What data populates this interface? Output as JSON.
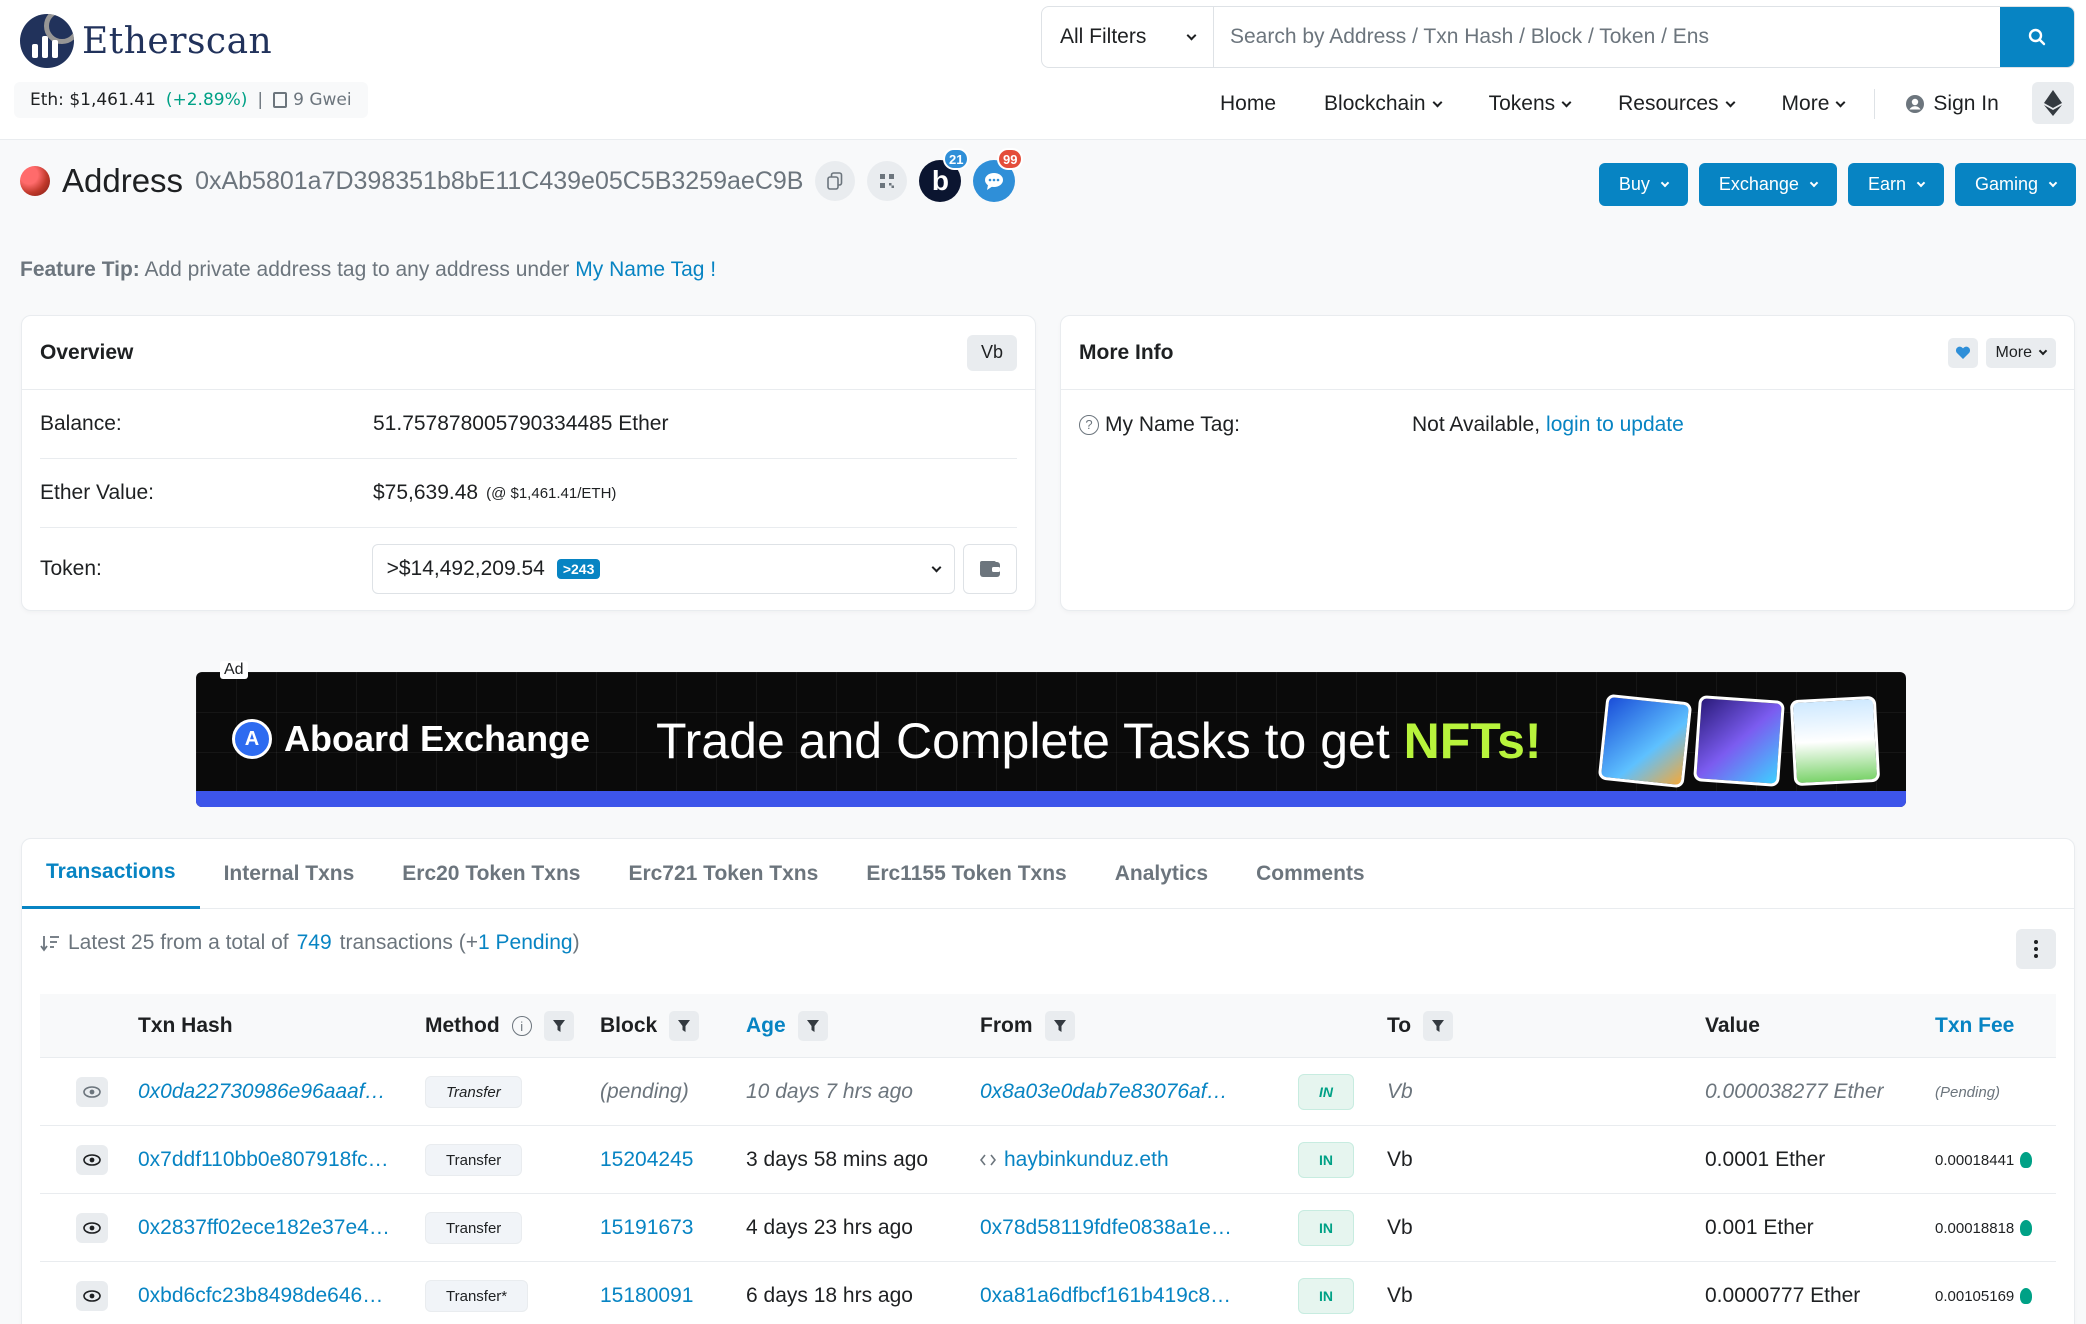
{
  "header": {
    "logo_text": "Etherscan",
    "eth_price": "Eth: $1,461.41",
    "eth_change": "(+2.89%)",
    "separator": "|",
    "gas": "9 Gwei",
    "search": {
      "filter_label": "All Filters",
      "placeholder": "Search by Address / Txn Hash / Block / Token / Ens"
    },
    "nav": [
      {
        "label": "Home"
      },
      {
        "label": "Blockchain"
      },
      {
        "label": "Tokens"
      },
      {
        "label": "Resources"
      },
      {
        "label": "More"
      }
    ],
    "sign_in": "Sign In"
  },
  "address": {
    "title": "Address",
    "hash": "0xAb5801a7D398351b8bE11C439e05C5B3259aeC9B",
    "b_badge_letter": "b",
    "b_badge_count": "21",
    "chat_badge_count": "99",
    "actions": [
      {
        "label": "Buy"
      },
      {
        "label": "Exchange"
      },
      {
        "label": "Earn"
      },
      {
        "label": "Gaming"
      }
    ]
  },
  "tip": {
    "label": "Feature Tip:",
    "text": "Add private address tag to any address under",
    "link": "My Name Tag !"
  },
  "overview": {
    "title": "Overview",
    "tag": "Vb",
    "balance_label": "Balance:",
    "balance_value": "51.757878005790334485 Ether",
    "ether_value_label": "Ether Value:",
    "ether_value": "$75,639.48",
    "ether_value_note": "(@ $1,461.41/ETH)",
    "token_label": "Token:",
    "token_value": ">$14,492,209.54",
    "token_count": ">243"
  },
  "more_info": {
    "title": "More Info",
    "more_label": "More",
    "name_tag_label": "My Name Tag:",
    "name_tag_value": "Not Available,",
    "name_tag_link": "login to update"
  },
  "ad": {
    "label": "Ad",
    "brand": "Aboard Exchange",
    "tagline": "Trade and Complete Tasks to get ",
    "tagline_highlight": "NFTs!"
  },
  "transactions": {
    "tabs": [
      {
        "label": "Transactions"
      },
      {
        "label": "Internal Txns"
      },
      {
        "label": "Erc20 Token Txns"
      },
      {
        "label": "Erc721 Token Txns"
      },
      {
        "label": "Erc1155 Token Txns"
      },
      {
        "label": "Analytics"
      },
      {
        "label": "Comments"
      }
    ],
    "summary_prefix": "Latest 25 from a total of",
    "summary_total": "749",
    "summary_mid": "transactions (+",
    "summary_pending": "1 Pending",
    "summary_suffix": ")",
    "columns": {
      "hash": "Txn Hash",
      "method": "Method",
      "block": "Block",
      "age": "Age",
      "from": "From",
      "to": "To",
      "value": "Value",
      "fee": "Txn Fee"
    },
    "rows": [
      {
        "hash": "0x0da22730986e96aaaf…",
        "method": "Transfer",
        "block": "(pending)",
        "age": "10 days 7 hrs ago",
        "from": "0x8a03e0dab7e83076af…",
        "direction": "IN",
        "to": "Vb",
        "value": "0.000038277 Ether",
        "fee": "(Pending)"
      },
      {
        "hash": "0x7ddf110bb0e807918fc…",
        "method": "Transfer",
        "block": "15204245",
        "age": "3 days 58 mins ago",
        "from": "haybinkunduz.eth",
        "direction": "IN",
        "to": "Vb",
        "value": "0.0001 Ether",
        "fee": "0.00018441"
      },
      {
        "hash": "0x2837ff02ece182e37e4…",
        "method": "Transfer",
        "block": "15191673",
        "age": "4 days 23 hrs ago",
        "from": "0x78d58119fdfe0838a1e…",
        "direction": "IN",
        "to": "Vb",
        "value": "0.001 Ether",
        "fee": "0.00018818"
      },
      {
        "hash": "0xbd6cfc23b8498de646…",
        "method": "Transfer*",
        "block": "15180091",
        "age": "6 days 18 hrs ago",
        "from": "0xa81a6dfbcf161b419c8…",
        "direction": "IN",
        "to": "Vb",
        "value": "0.0000777 Ether",
        "fee": "0.00105169"
      }
    ]
  },
  "colors": {
    "accent": "#0784c3",
    "brand": "#21325b",
    "positive": "#00a186",
    "muted": "#6c757d"
  }
}
